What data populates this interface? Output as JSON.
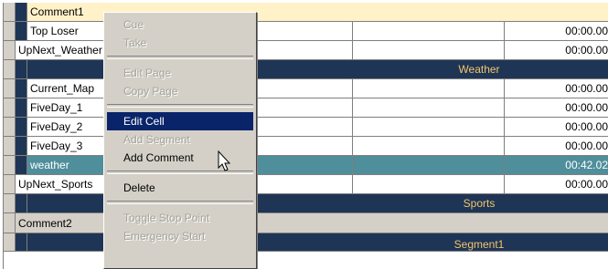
{
  "grid": {
    "rows": [
      {
        "type": "comment",
        "name": "Comment1"
      },
      {
        "type": "item",
        "name": "Top Loser",
        "time": "00:00.00"
      },
      {
        "type": "upnext",
        "name": "UpNext_Weather",
        "time": "00:00.00"
      },
      {
        "type": "section",
        "label": "Weather"
      },
      {
        "type": "item",
        "name": "Current_Map",
        "time": "00:00.00"
      },
      {
        "type": "item",
        "name": "FiveDay_1",
        "time": "00:00.00"
      },
      {
        "type": "item",
        "name": "FiveDay_2",
        "time": "00:00.00"
      },
      {
        "type": "item",
        "name": "FiveDay_3",
        "time": "00:00.00"
      },
      {
        "type": "selected",
        "name": "weather",
        "time": "00:42.02"
      },
      {
        "type": "upnext",
        "name": "UpNext_Sports",
        "time": "00:00.00"
      },
      {
        "type": "section",
        "label": "Sports"
      },
      {
        "type": "comment2",
        "name": "Comment2"
      },
      {
        "type": "section",
        "label": "Segment1"
      }
    ]
  },
  "context_menu": {
    "items": [
      {
        "label": "Cue",
        "enabled": false
      },
      {
        "label": "Take",
        "enabled": false
      },
      {
        "label": "Edit Page",
        "enabled": false
      },
      {
        "label": "Copy Page",
        "enabled": false
      },
      {
        "label": "Edit Cell",
        "enabled": true,
        "highlighted": true
      },
      {
        "label": "Add Segment",
        "enabled": false
      },
      {
        "label": "Add Comment",
        "enabled": true
      },
      {
        "label": "Delete",
        "enabled": true
      },
      {
        "label": "Toggle Stop Point",
        "enabled": false
      },
      {
        "label": "Emergency Start",
        "enabled": false
      }
    ]
  },
  "colors": {
    "section_bg": "#1e3556",
    "section_text": "#f2c469",
    "selected_row": "#4f8e9b",
    "comment_row": "#fff2c8",
    "menu_bg": "#d4d0c8",
    "menu_highlight": "#0a246a"
  },
  "cursor_icon": "arrow-pointer-icon"
}
